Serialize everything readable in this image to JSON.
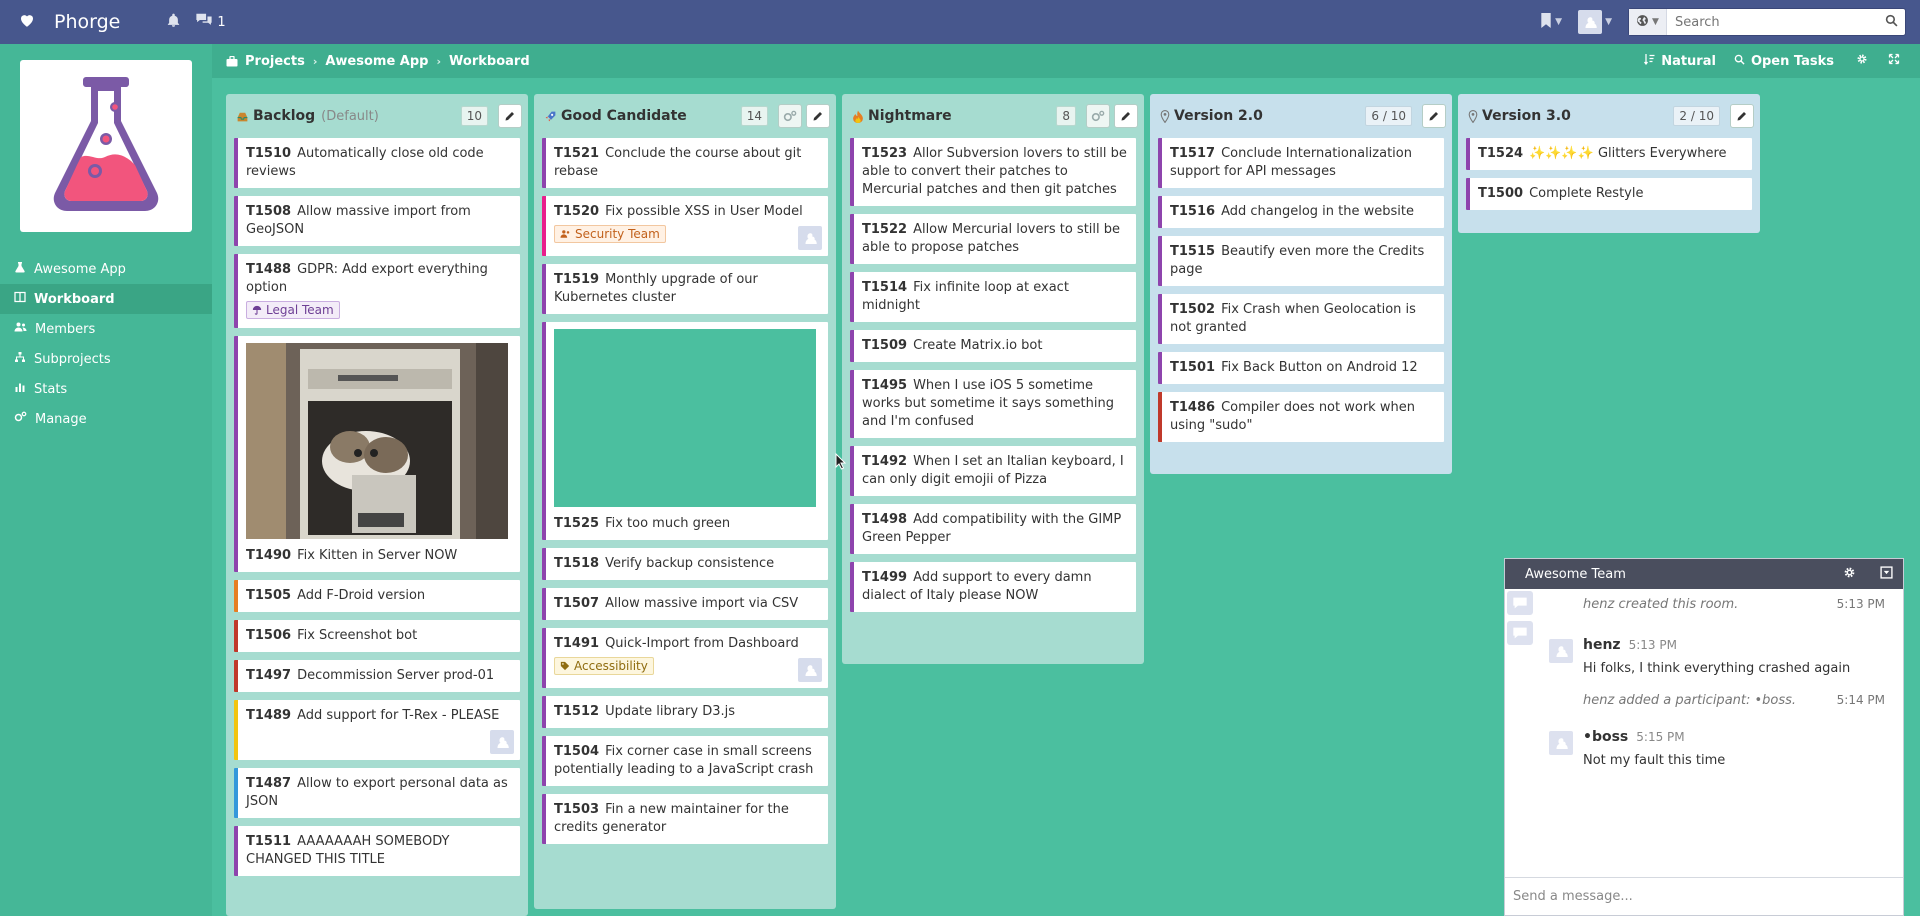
{
  "app": {
    "name": "Phorge",
    "notification_count": "1"
  },
  "search": {
    "placeholder": "Search"
  },
  "breadcrumb": [
    "Projects",
    "Awesome App",
    "Workboard"
  ],
  "crumb_actions": {
    "sort": "Natural",
    "filter": "Open Tasks"
  },
  "sidebar": {
    "items": [
      {
        "label": "Awesome App"
      },
      {
        "label": "Workboard"
      },
      {
        "label": "Members"
      },
      {
        "label": "Subprojects"
      },
      {
        "label": "Stats"
      },
      {
        "label": "Manage"
      }
    ]
  },
  "columns": [
    {
      "title": "Backlog",
      "subtitle": "(Default)",
      "count": "10",
      "cards": [
        {
          "id": "T1510",
          "title": "Automatically close old code reviews"
        },
        {
          "id": "T1508",
          "title": "Allow massive import from GeoJSON"
        },
        {
          "id": "T1488",
          "title": "GDPR: Add export everything option",
          "tag": "Legal Team"
        },
        {
          "id": "T1490",
          "title": "Fix Kitten in Server NOW"
        },
        {
          "id": "T1505",
          "title": "Add F-Droid version"
        },
        {
          "id": "T1506",
          "title": "Fix Screenshot bot"
        },
        {
          "id": "T1497",
          "title": "Decommission Server prod-01"
        },
        {
          "id": "T1489",
          "title": "Add support for T-Rex - PLEASE"
        },
        {
          "id": "T1487",
          "title": "Allow to export personal data as JSON"
        },
        {
          "id": "T1511",
          "title": "AAAAAAAH SOMEBODY CHANGED THIS TITLE"
        }
      ]
    },
    {
      "title": "Good Candidate",
      "count": "14",
      "cards": [
        {
          "id": "T1521",
          "title": "Conclude the course about git rebase"
        },
        {
          "id": "T1520",
          "title": "Fix possible XSS in User Model",
          "tag": "Security Team"
        },
        {
          "id": "T1519",
          "title": "Monthly upgrade of our Kubernetes cluster"
        },
        {
          "id": "T1525",
          "title": "Fix too much green"
        },
        {
          "id": "T1518",
          "title": "Verify backup consistence"
        },
        {
          "id": "T1507",
          "title": "Allow massive import via CSV"
        },
        {
          "id": "T1491",
          "title": "Quick-Import from Dashboard",
          "tag": "Accessibility"
        },
        {
          "id": "T1512",
          "title": "Update library D3.js"
        },
        {
          "id": "T1504",
          "title": "Fix corner case in small screens potentially leading to a JavaScript crash"
        },
        {
          "id": "T1503",
          "title": "Fin a new maintainer for the credits generator"
        }
      ]
    },
    {
      "title": "Nightmare",
      "count": "8",
      "cards": [
        {
          "id": "T1523",
          "title": "Allor Subversion lovers to still be able to convert their patches to Mercurial patches and then git patches"
        },
        {
          "id": "T1522",
          "title": "Allow Mercurial lovers to still be able to propose patches"
        },
        {
          "id": "T1514",
          "title": "Fix infinite loop at exact midnight"
        },
        {
          "id": "T1509",
          "title": "Create Matrix.io bot"
        },
        {
          "id": "T1495",
          "title": "When I use iOS 5 sometime works but sometime it says something and I'm confused"
        },
        {
          "id": "T1492",
          "title": "When I set an Italian keyboard, I can only digit emojii of Pizza"
        },
        {
          "id": "T1498",
          "title": "Add compatibility with the GIMP Green Pepper"
        },
        {
          "id": "T1499",
          "title": "Add support to every damn dialect of Italy please NOW"
        }
      ]
    },
    {
      "title": "Version 2.0",
      "count": "6 / 10",
      "cards": [
        {
          "id": "T1517",
          "title": "Conclude Internationalization support for API messages"
        },
        {
          "id": "T1516",
          "title": "Add changelog in the website"
        },
        {
          "id": "T1515",
          "title": "Beautify even more the Credits page"
        },
        {
          "id": "T1502",
          "title": "Fix Crash when Geolocation is not granted"
        },
        {
          "id": "T1501",
          "title": "Fix Back Button on Android 12"
        },
        {
          "id": "T1486",
          "title": "Compiler does not work when using \"sudo\""
        }
      ]
    },
    {
      "title": "Version 3.0",
      "count": "2 / 10",
      "cards": [
        {
          "id": "T1524",
          "title": "✨✨✨✨ Glitters Everywhere"
        },
        {
          "id": "T1500",
          "title": "Complete Restyle"
        }
      ]
    }
  ],
  "chat": {
    "room": "Awesome Team",
    "messages": [
      {
        "actor": "henz",
        "text": "created this room.",
        "time": "5:13 PM"
      },
      {
        "author": "henz",
        "time": "5:13 PM",
        "text": "Hi folks, I think everything crashed again"
      },
      {
        "actor": "henz",
        "text": "added a participant: •boss.",
        "time": "5:14 PM"
      },
      {
        "author": "•boss",
        "time": "5:15 PM",
        "text": "Not my fault this time"
      }
    ],
    "placeholder": "Send a message..."
  },
  "colors": {
    "header": "#47578d",
    "board_bg": "#4bbf9f",
    "column_bg": "#a6dcd0",
    "milestone_bg": "#c7e0ec",
    "card_border": "#8e44ad",
    "chat_header": "#4a4e5e"
  },
  "icons": {
    "logo": "heart-icon",
    "notifications": "bell-icon",
    "conpherence": "chat-bubbles-icon",
    "bookmark": "bookmark-icon",
    "avatar": "avatar-icon",
    "search": "magnifier-icon",
    "project_image": "flask-icon"
  }
}
